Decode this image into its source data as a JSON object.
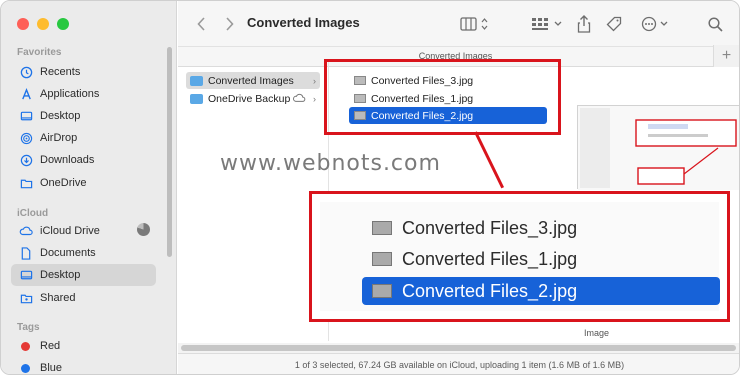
{
  "window_title": "Converted Images",
  "pathbar_title": "Converted Images",
  "sidebar": {
    "sections": [
      {
        "header": "Favorites",
        "items": [
          {
            "label": "Recents",
            "icon": "clock-icon"
          },
          {
            "label": "Applications",
            "icon": "applications-icon"
          },
          {
            "label": "Desktop",
            "icon": "desktop-icon"
          },
          {
            "label": "AirDrop",
            "icon": "airdrop-icon"
          },
          {
            "label": "Downloads",
            "icon": "downloads-icon"
          },
          {
            "label": "OneDrive",
            "icon": "folder-icon"
          }
        ]
      },
      {
        "header": "iCloud",
        "items": [
          {
            "label": "iCloud Drive",
            "icon": "cloud-icon"
          },
          {
            "label": "Documents",
            "icon": "document-icon"
          },
          {
            "label": "Desktop",
            "icon": "desktop-icon",
            "selected": true
          },
          {
            "label": "Shared",
            "icon": "shared-folder-icon"
          }
        ]
      },
      {
        "header": "Tags",
        "items": [
          {
            "label": "Red",
            "color": "#e53935"
          },
          {
            "label": "Blue",
            "color": "#1e73e8"
          }
        ]
      }
    ]
  },
  "column1": [
    {
      "label": "Converted Images",
      "selected": true,
      "arrow": "›"
    },
    {
      "label": "OneDrive Backup",
      "selected": false,
      "arrow": "›",
      "cloud": true
    }
  ],
  "column2": [
    {
      "label": "Converted Files_3.jpg",
      "selected": false
    },
    {
      "label": "Converted Files_1.jpg",
      "selected": false
    },
    {
      "label": "Converted Files_2.jpg",
      "selected": true
    }
  ],
  "zoom_rows": [
    {
      "label": "Converted Files_3.jpg",
      "selected": false
    },
    {
      "label": "Converted Files_1.jpg",
      "selected": false
    },
    {
      "label": "Converted Files_2.jpg",
      "selected": true
    }
  ],
  "watermark": "www.webnots.com",
  "preview_label": "Image",
  "status_text": "1 of 3 selected, 67.24 GB available on iCloud, uploading 1 item (1.6 MB of 1.6 MB)",
  "colors": {
    "accent": "#1762d8",
    "callout": "#d9141c",
    "traffic_red": "#fe5f57",
    "traffic_yellow": "#febc2e",
    "traffic_green": "#28c840"
  },
  "icloud_upload_progress": 0.8
}
